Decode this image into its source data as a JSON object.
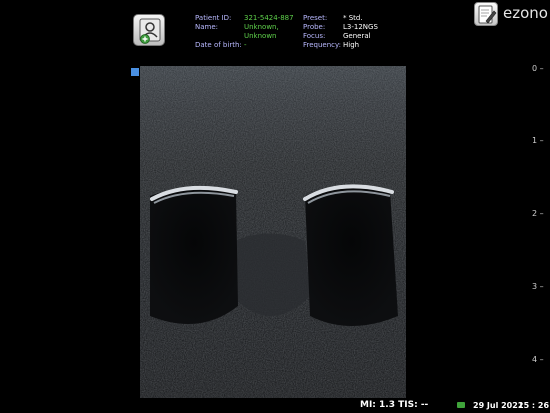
{
  "patient": {
    "id_label": "Patient ID:",
    "id_value": "321-5424-887",
    "name_label": "Name:",
    "name_value_1": "Unknown,",
    "name_value_2": "Unknown",
    "dob_label": "Date of birth:",
    "dob_value": "-"
  },
  "settings": {
    "preset_label": "Preset:",
    "preset_value": "* Std.",
    "probe_label": "Probe:",
    "probe_value": "L3-12NGS",
    "focus_label": "Focus:",
    "focus_value": "General",
    "frequency_label": "Frequency:",
    "frequency_value": "High"
  },
  "brand": "ezono",
  "depth_scale": {
    "ticks": [
      "0",
      "1",
      "2",
      "3",
      "4"
    ]
  },
  "status": {
    "mi_text": "MI: 1.3  TIS: --",
    "date": "29 Jul 2022",
    "time": "15 : 26"
  },
  "icons": {
    "patient": "patient-add-icon",
    "notes": "notes-pen-icon",
    "marker": "orientation-marker-icon",
    "battery": "battery-icon"
  },
  "colors": {
    "label": "#b9b9ff",
    "value": "#5fd14b",
    "marker": "#4a90e2",
    "background": "#000000"
  }
}
